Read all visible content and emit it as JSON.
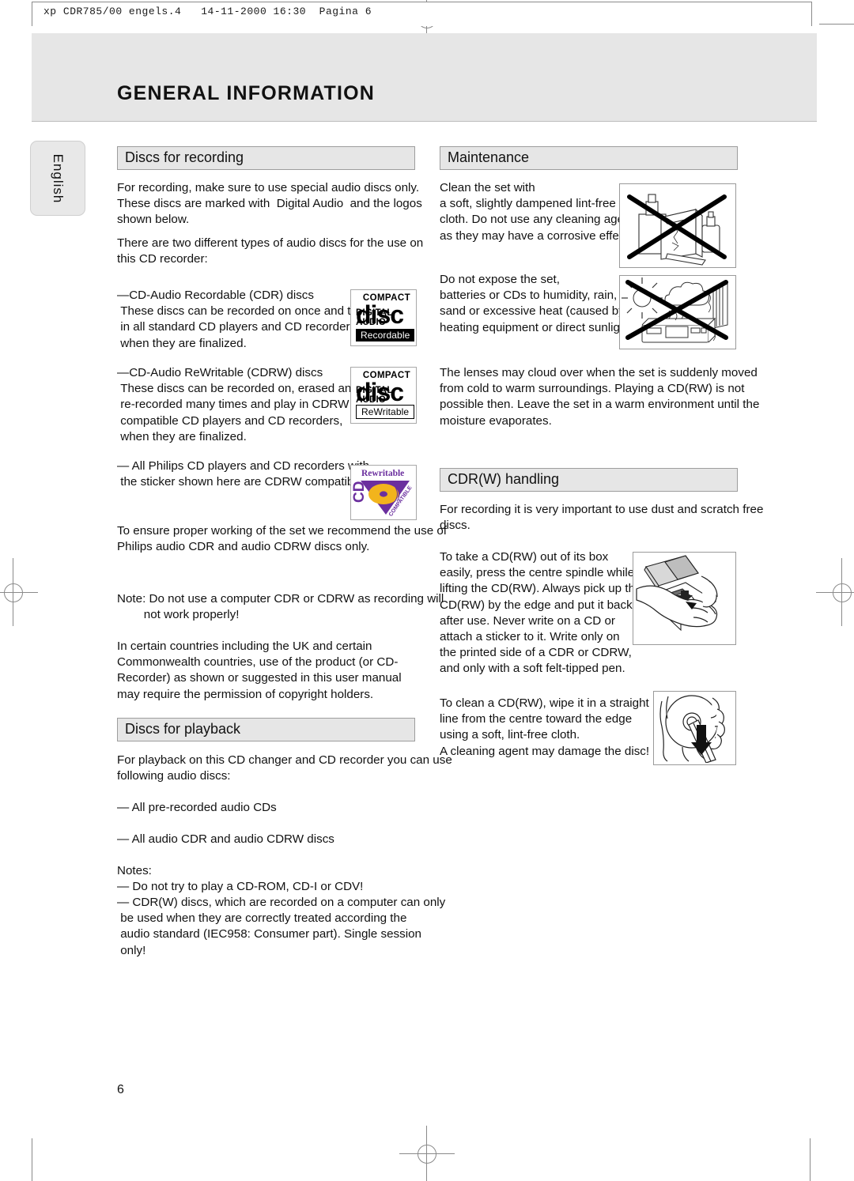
{
  "meta": {
    "slug": "xp CDR785/00 engels.4   14-11-2000 16:30  Pagina 6",
    "page_number": "6",
    "language_tab": "English"
  },
  "header": {
    "title": "GENERAL INFORMATION"
  },
  "sections": {
    "discs_for_recording": {
      "heading": "Discs for recording",
      "intro": "For recording, make sure to use special audio discs only.\nThese discs are marked with  Digital Audio  and the logos\nshown below.",
      "types_intro": "There are two different types of audio discs for the use on\nthis CD recorder:",
      "cdr_item": "—CD-Audio Recordable (CDR) discs\n These discs can be recorded on once and then play\n in all standard CD players and CD recorders,\n when they are finalized.",
      "cdrw_item": "—CD-Audio ReWritable (CDRW) discs\n These discs can be recorded on, erased and\n re-recorded many times and play in CDRW\n compatible CD players and CD recorders,\n when they are finalized.",
      "philips_item": "— All Philips CD players and CD recorders with\n the sticker shown here are CDRW compatible.",
      "recommend": "To ensure proper working of the set we recommend the use of\nPhilips audio CDR and audio CDRW discs only.",
      "note": "Note: Do not use a computer CDR or CDRW as recording will\n        not work properly!",
      "copyright": "In certain countries including the UK and certain\nCommonwealth countries, use of the product (or CD-\nRecorder) as shown or suggested in this user manual\nmay require the permission of copyright holders."
    },
    "discs_for_playback": {
      "heading": "Discs for playback",
      "intro": "For playback on this CD changer and CD recorder you can use\nfollowing audio discs:",
      "bullet1": "— All pre-recorded audio CDs",
      "bullet2": "— All audio CDR and audio CDRW discs",
      "notes_label": "Notes:",
      "note1": "— Do not try to play a CD-ROM, CD-I or CDV!",
      "note2": "— CDR(W) discs, which are recorded on a computer can only\n be used when they are correctly treated according the\n audio standard (IEC958: Consumer part). Single session\n only!"
    },
    "maintenance": {
      "heading": "Maintenance",
      "clean": "Clean the set with\na soft, slightly dampened lint-free\ncloth. Do not use any cleaning agents\nas they may have a corrosive effect.",
      "expose": "Do not expose the set,\nbatteries or CDs to humidity, rain,\nsand or excessive heat (caused by\nheating equipment or direct sunlight).",
      "lenses": "The lenses may cloud over when the set is suddenly moved\nfrom cold to warm surroundings. Playing a CD(RW) is not\npossible then. Leave the set in a warm environment until the\nmoisture evaporates."
    },
    "cdrw_handling": {
      "heading": "CDR(W) handling",
      "intro": "For recording it is very important to use dust and scratch free\ndiscs.",
      "take_out": "To take a CD(RW) out of its box\neasily, press the centre spindle while\nlifting the CD(RW). Always pick up the\nCD(RW) by the edge and put it back\nafter use. Never write on a CD or\nattach a sticker to it. Write only on\nthe printed side of a CDR or CDRW,\nand only with a soft felt-tipped pen.",
      "clean_disc": "To clean a CD(RW), wipe it in a straight\nline from the centre toward the edge\nusing a soft, lint-free cloth.\nA cleaning agent may damage the disc!"
    }
  },
  "logos": {
    "cdr": {
      "compact": "COMPACT",
      "disc": "disc",
      "digital_audio": "DIGITAL AUDIO",
      "badge": "Recordable"
    },
    "cdrw": {
      "compact": "COMPACT",
      "disc": "disc",
      "digital_audio": "DIGITAL AUDIO",
      "badge": "ReWritable"
    },
    "rewritable_sticker": {
      "top": "Rewritable",
      "cd": "CD",
      "compatible": "COMPATIBLE",
      "purple": "#6b2f9e",
      "gold": "#f2b41c"
    }
  },
  "figures": {
    "no_cleaning_agents": "no-cleaning-agents-illustration",
    "no_heat_humidity": "no-heat-humidity-illustration",
    "take_disc_from_box": "take-disc-from-box-illustration",
    "wipe_disc": "wipe-disc-illustration"
  }
}
